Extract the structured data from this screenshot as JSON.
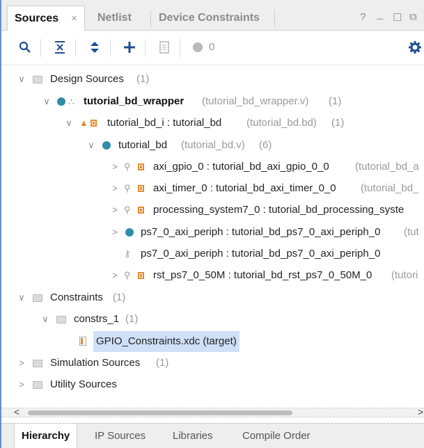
{
  "tabs": {
    "sources": "Sources",
    "close": "×",
    "netlist": "Netlist",
    "device_constraints": "Device Constraints"
  },
  "window_controls": {
    "help": "?",
    "minimize": "_",
    "maximize": "☐",
    "restore": "⧉"
  },
  "toolbar": {
    "unsaved_count": "0"
  },
  "tree": {
    "design_sources": {
      "label": "Design Sources",
      "count": "(1)"
    },
    "wrapper": {
      "label": "tutorial_bd_wrapper",
      "file": "(tutorial_bd_wrapper.v)",
      "count": "(1)"
    },
    "bd_i": {
      "label": "tutorial_bd_i : tutorial_bd",
      "file": "(tutorial_bd.bd)",
      "count": "(1)"
    },
    "bd": {
      "label": "tutorial_bd",
      "file": "(tutorial_bd.v)",
      "count": "(6)"
    },
    "gpio": {
      "label": "axi_gpio_0 : tutorial_bd_axi_gpio_0_0",
      "file": "(tutorial_bd_a"
    },
    "timer": {
      "label": "axi_timer_0 : tutorial_bd_axi_timer_0_0",
      "file": "(tutorial_bd_"
    },
    "ps7": {
      "label": "processing_system7_0 : tutorial_bd_processing_syste",
      "file": ""
    },
    "periph": {
      "label": "ps7_0_axi_periph : tutorial_bd_ps7_0_axi_periph_0",
      "file": "(tut"
    },
    "periph2": {
      "label": "ps7_0_axi_periph : tutorial_bd_ps7_0_axi_periph_0"
    },
    "rst": {
      "label": "rst_ps7_0_50M : tutorial_bd_rst_ps7_0_50M_0",
      "file": "(tutori"
    },
    "constraints": {
      "label": "Constraints",
      "count": "(1)"
    },
    "constrs_1": {
      "label": "constrs_1",
      "count": "(1)"
    },
    "xdc": {
      "label": "GPIO_Constraints.xdc (target)"
    },
    "sim_sources": {
      "label": "Simulation Sources",
      "count": "(1)"
    },
    "utility_sources": {
      "label": "Utility Sources"
    }
  },
  "bottom_tabs": [
    "Hierarchy",
    "IP Sources",
    "Libraries",
    "Compile Order"
  ],
  "colors": {
    "accent_blue": "#2f8ea8",
    "ip_orange": "#e58a2c",
    "selection": "#cfe0f7"
  }
}
